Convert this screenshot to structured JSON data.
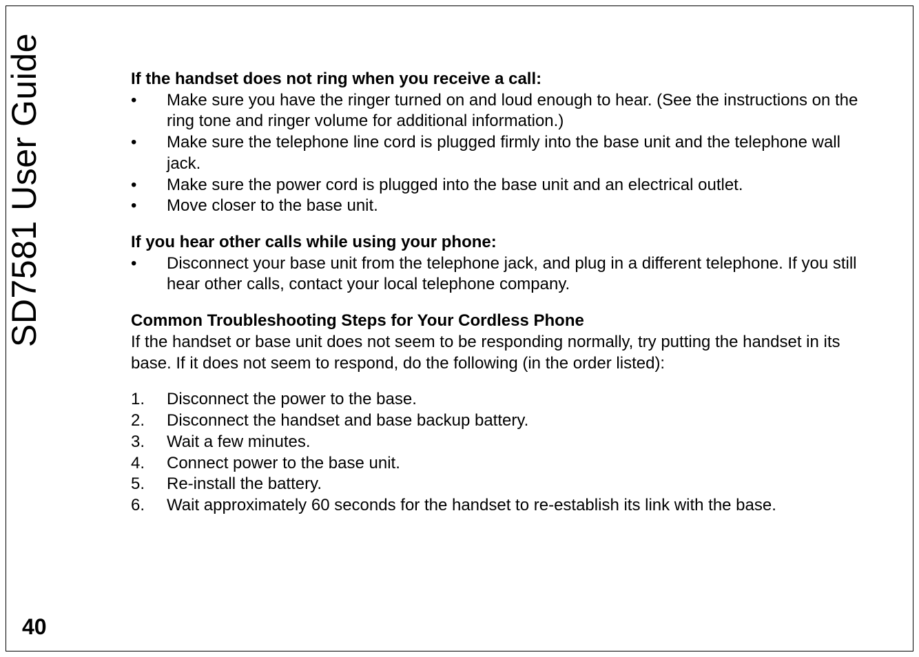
{
  "sidebar": {
    "vertical_label": "SD7581 User Guide",
    "page_number": "40"
  },
  "sections": {
    "s1": {
      "heading": "If the handset does not ring when you receive a call:",
      "bullets": [
        "Make sure you have the ringer turned on and loud enough to hear. (See the instructions on the ring tone and ringer volume for additional information.)",
        "Make sure the telephone line cord is plugged firmly into the base unit and the telephone wall jack.",
        "Make sure the power cord is plugged into the base unit and an electrical outlet.",
        "Move closer to the base unit."
      ]
    },
    "s2": {
      "heading": "If you hear other calls while using your phone:",
      "bullets": [
        "Disconnect your base unit from the telephone jack, and plug in a different telephone. If you still hear other calls, contact your local telephone company."
      ]
    },
    "s3": {
      "heading": "Common Troubleshooting Steps for Your Cordless Phone",
      "intro": "If the handset or base unit does not seem to be responding normally, try putting the handset in its base. If it does not seem to respond, do the following (in the order listed):",
      "steps": [
        {
          "num": "1.",
          "text": "Disconnect the power to the base."
        },
        {
          "num": "2.",
          "text": "Disconnect the handset and base backup battery."
        },
        {
          "num": "3.",
          "text": "Wait a few minutes."
        },
        {
          "num": "4.",
          "text": "Connect power to the base unit."
        },
        {
          "num": "5.",
          "text": "Re-install the battery."
        },
        {
          "num": "6.",
          "text": "Wait approximately 60 seconds for the handset to re-establish its link with the base."
        }
      ]
    }
  }
}
